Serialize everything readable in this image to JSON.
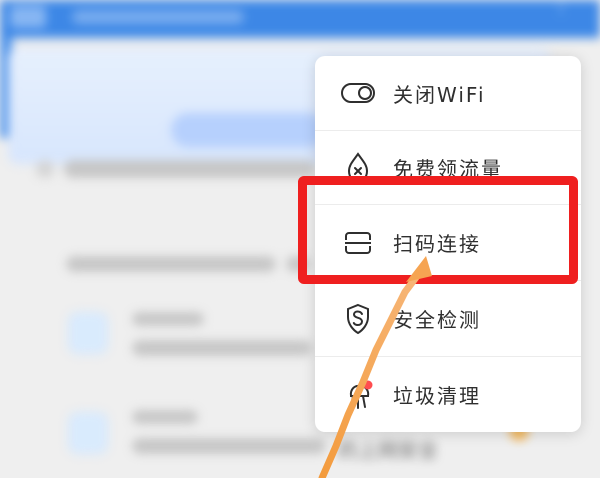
{
  "menu": {
    "items": [
      {
        "label": "关闭WiFi",
        "icon": "toggle-switch-icon"
      },
      {
        "label": "免费领流量",
        "icon": "flow-drop-icon"
      },
      {
        "label": "扫码连接",
        "icon": "scan-code-icon"
      },
      {
        "label": "安全检测",
        "icon": "shield-s-icon"
      },
      {
        "label": "垃圾清理",
        "icon": "cleanup-icon"
      }
    ]
  },
  "background": {
    "bottom_text": "的上网安全"
  },
  "colors": {
    "primary_blue": "#2e7fe6",
    "highlight_red": "#ef1f1f",
    "arrow_orange": "#f7a04a",
    "badge_red": "#ff4d4f",
    "orange_badge": "#f8a320"
  }
}
